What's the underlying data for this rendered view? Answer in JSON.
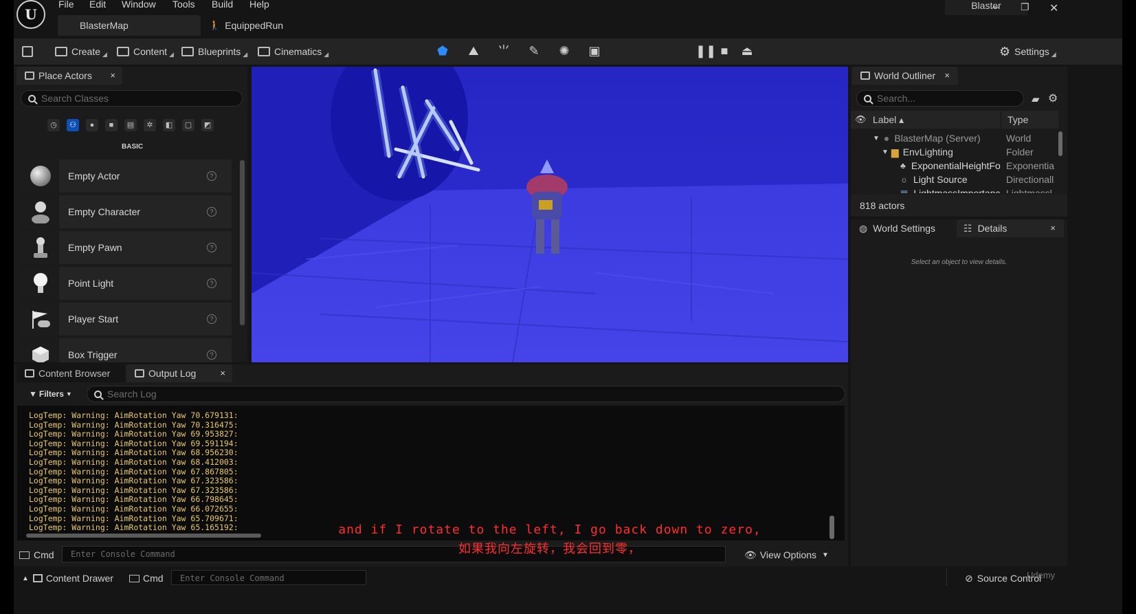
{
  "menu": [
    "File",
    "Edit",
    "Window",
    "Tools",
    "Build",
    "Help"
  ],
  "document_tabs": [
    {
      "label": "BlasterMap"
    },
    {
      "label": "EquippedRun"
    }
  ],
  "window": {
    "title": "Blaster",
    "minimize": "–",
    "restore": "❐",
    "close": "✕"
  },
  "logo": "U",
  "toolbar": {
    "save": "save-icon",
    "create": "Create",
    "content": "Content",
    "blueprints": "Blueprints",
    "cinematics": "Cinematics",
    "settings": "Settings",
    "accent": "#0e7bf0"
  },
  "place_actors": {
    "tab": "Place Actors",
    "close": "×",
    "search_placeholder": "Search Classes",
    "category": "BASIC",
    "categories": [
      "recent-icon",
      "basic-icon",
      "lights-icon",
      "shapes-icon",
      "cinematic-icon",
      "visual-effects-icon",
      "geometry-icon",
      "volumes-icon",
      "all-classes-icon"
    ],
    "items": [
      {
        "label": "Empty Actor",
        "icon": "sphere-icon"
      },
      {
        "label": "Empty Character",
        "icon": "character-icon"
      },
      {
        "label": "Empty Pawn",
        "icon": "pawn-icon"
      },
      {
        "label": "Point Light",
        "icon": "light-bulb-icon"
      },
      {
        "label": "Player Start",
        "icon": "flag-gamepad-icon"
      },
      {
        "label": "Box Trigger",
        "icon": "box-icon"
      }
    ],
    "help": "?"
  },
  "outliner": {
    "tab": "World Outliner",
    "close": "×",
    "search_placeholder": "Search...",
    "col_label": "Label ▴",
    "col_type": "Type",
    "rows": [
      {
        "label": "BlasterMap (Server)",
        "type": "World"
      },
      {
        "label": "EnvLighting",
        "type": "Folder"
      },
      {
        "label": "ExponentialHeightFo",
        "type": "Exponentia"
      },
      {
        "label": "Light Source",
        "type": "Directionall"
      },
      {
        "label": "LightmassImportanc",
        "type": "Lightmassl"
      }
    ],
    "count": "818 actors"
  },
  "details": {
    "tab_world_settings": "World Settings",
    "tab_details": "Details",
    "close": "×",
    "empty_message": "Select an object to view details."
  },
  "bottom_tabs": {
    "content_browser": "Content Browser",
    "output_log": "Output Log",
    "close": "×"
  },
  "output_log": {
    "filters": "Filters",
    "search_placeholder": "Search Log",
    "lines": [
      "LogTemp: Warning: AimRotation Yaw 70.679131:",
      "LogTemp: Warning: AimRotation Yaw 70.316475:",
      "LogTemp: Warning: AimRotation Yaw 69.953827:",
      "LogTemp: Warning: AimRotation Yaw 69.591194:",
      "LogTemp: Warning: AimRotation Yaw 68.956230:",
      "LogTemp: Warning: AimRotation Yaw 68.412003:",
      "LogTemp: Warning: AimRotation Yaw 67.867805:",
      "LogTemp: Warning: AimRotation Yaw 67.323586:",
      "LogTemp: Warning: AimRotation Yaw 67.323586:",
      "LogTemp: Warning: AimRotation Yaw 66.798645:",
      "LogTemp: Warning: AimRotation Yaw 66.072655:",
      "LogTemp: Warning: AimRotation Yaw 65.709671:",
      "LogTemp: Warning: AimRotation Yaw 65.165192:"
    ],
    "log_color": "#e8c86a",
    "cmd_label": "Cmd",
    "console_placeholder": "Enter Console Command",
    "view_options": "View Options"
  },
  "subtitles": {
    "english": "and if I rotate to the left, I go back down to zero,",
    "chinese": "如果我向左旋转，我会回到零，",
    "color": "#ff2e2e"
  },
  "status_bar": {
    "content_drawer": "Content Drawer",
    "cmd": "Cmd",
    "console_placeholder": "Enter Console Command",
    "source_control": "Source Control",
    "watermark": "Udemy"
  }
}
